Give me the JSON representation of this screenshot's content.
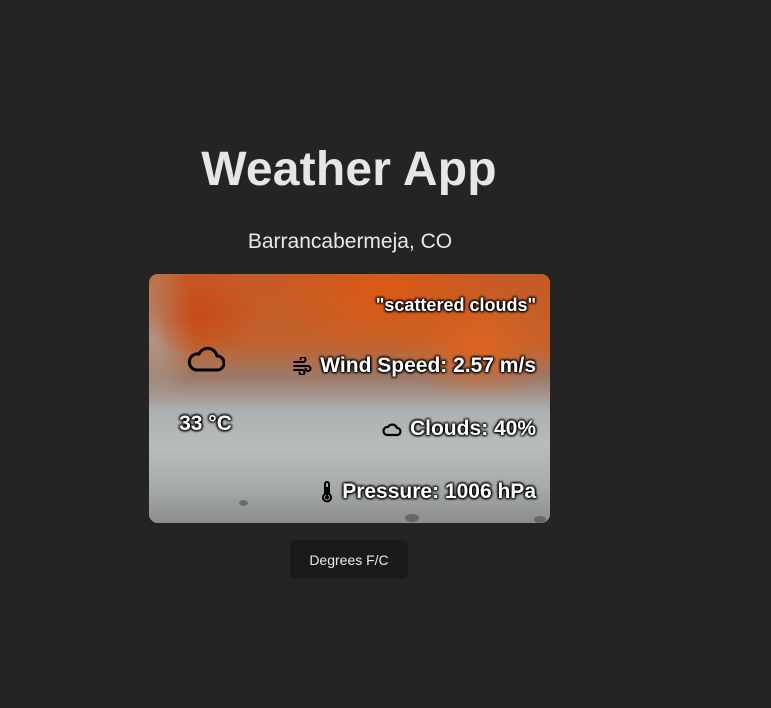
{
  "app": {
    "title": "Weather App"
  },
  "location": {
    "city": "Barrancabermeja, CO"
  },
  "weather": {
    "description": "\"scattered clouds\"",
    "temperature": "33 °C",
    "icon": "cloud-icon",
    "wind_speed": "Wind Speed: 2.57 m/s",
    "wind_icon": "wind-icon",
    "clouds": "Clouds: 40%",
    "clouds_icon": "cloud-small-icon",
    "pressure": "Pressure: 1006 hPa",
    "pressure_icon": "thermometer-icon"
  },
  "controls": {
    "toggle_units_label": "Degrees F/C"
  },
  "colors": {
    "background": "#242424",
    "text": "#e8e8e8",
    "button_background": "#1a1a1a"
  }
}
